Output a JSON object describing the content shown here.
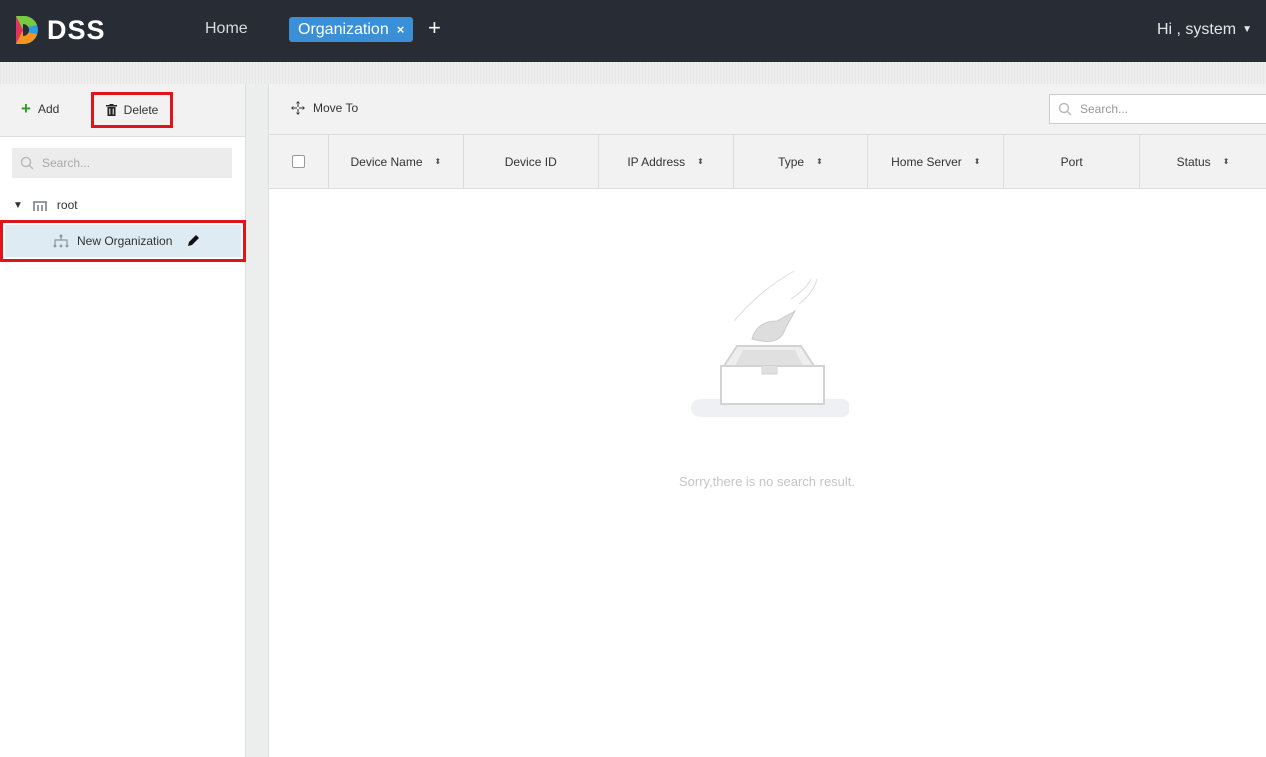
{
  "header": {
    "logo": "DSS",
    "home": "Home",
    "active_tab": "Organization",
    "tab_close": "×",
    "tab_add": "+",
    "user": "Hi , system",
    "user_caret": "▼"
  },
  "left": {
    "add": "Add",
    "delete": "Delete",
    "search_placeholder": "Search...",
    "root": "root",
    "child": "New Organization"
  },
  "right": {
    "move_to": "Move To",
    "search_placeholder": "Search...",
    "columns": [
      "Device Name",
      "Device ID",
      "IP Address",
      "Type",
      "Home Server",
      "Port",
      "Status"
    ],
    "empty": "Sorry,there is no search result."
  }
}
